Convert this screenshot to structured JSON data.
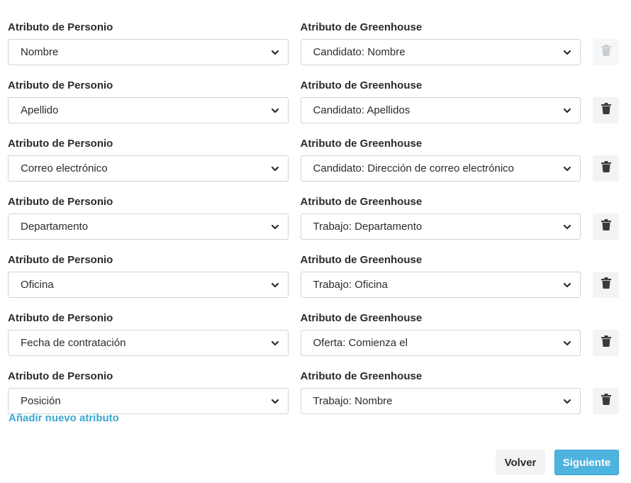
{
  "rows": [
    {
      "personio_label": "Atributo de Personio",
      "personio_value": "Nombre",
      "greenhouse_label": "Atributo de Greenhouse",
      "greenhouse_value": "Candidato: Nombre",
      "delete_disabled": true
    },
    {
      "personio_label": "Atributo de Personio",
      "personio_value": "Apellido",
      "greenhouse_label": "Atributo de Greenhouse",
      "greenhouse_value": "Candidato: Apellidos",
      "delete_disabled": false
    },
    {
      "personio_label": "Atributo de Personio",
      "personio_value": "Correo electrónico",
      "greenhouse_label": "Atributo de Greenhouse",
      "greenhouse_value": "Candidato: Dirección de correo electrónico",
      "delete_disabled": false
    },
    {
      "personio_label": "Atributo de Personio",
      "personio_value": "Departamento",
      "greenhouse_label": "Atributo de Greenhouse",
      "greenhouse_value": "Trabajo: Departamento",
      "delete_disabled": false
    },
    {
      "personio_label": "Atributo de Personio",
      "personio_value": "Oficina",
      "greenhouse_label": "Atributo de Greenhouse",
      "greenhouse_value": "Trabajo: Oficina",
      "delete_disabled": false
    },
    {
      "personio_label": "Atributo de Personio",
      "personio_value": "Fecha de contratación",
      "greenhouse_label": "Atributo de Greenhouse",
      "greenhouse_value": "Oferta: Comienza el",
      "delete_disabled": false
    },
    {
      "personio_label": "Atributo de Personio",
      "personio_value": "Posición",
      "greenhouse_label": "Atributo de Greenhouse",
      "greenhouse_value": "Trabajo: Nombre",
      "delete_disabled": false
    }
  ],
  "icons": {
    "dropdown": "chevron-down-icon",
    "delete": "trash-icon"
  },
  "add_link": "Añadir nuevo atributo",
  "buttons": {
    "back": "Volver",
    "next": "Siguiente"
  },
  "colors": {
    "accent": "#4db3df",
    "link": "#3aa8d2",
    "icon_active": "#3a3a3a",
    "icon_disabled": "#c9cdd0"
  }
}
